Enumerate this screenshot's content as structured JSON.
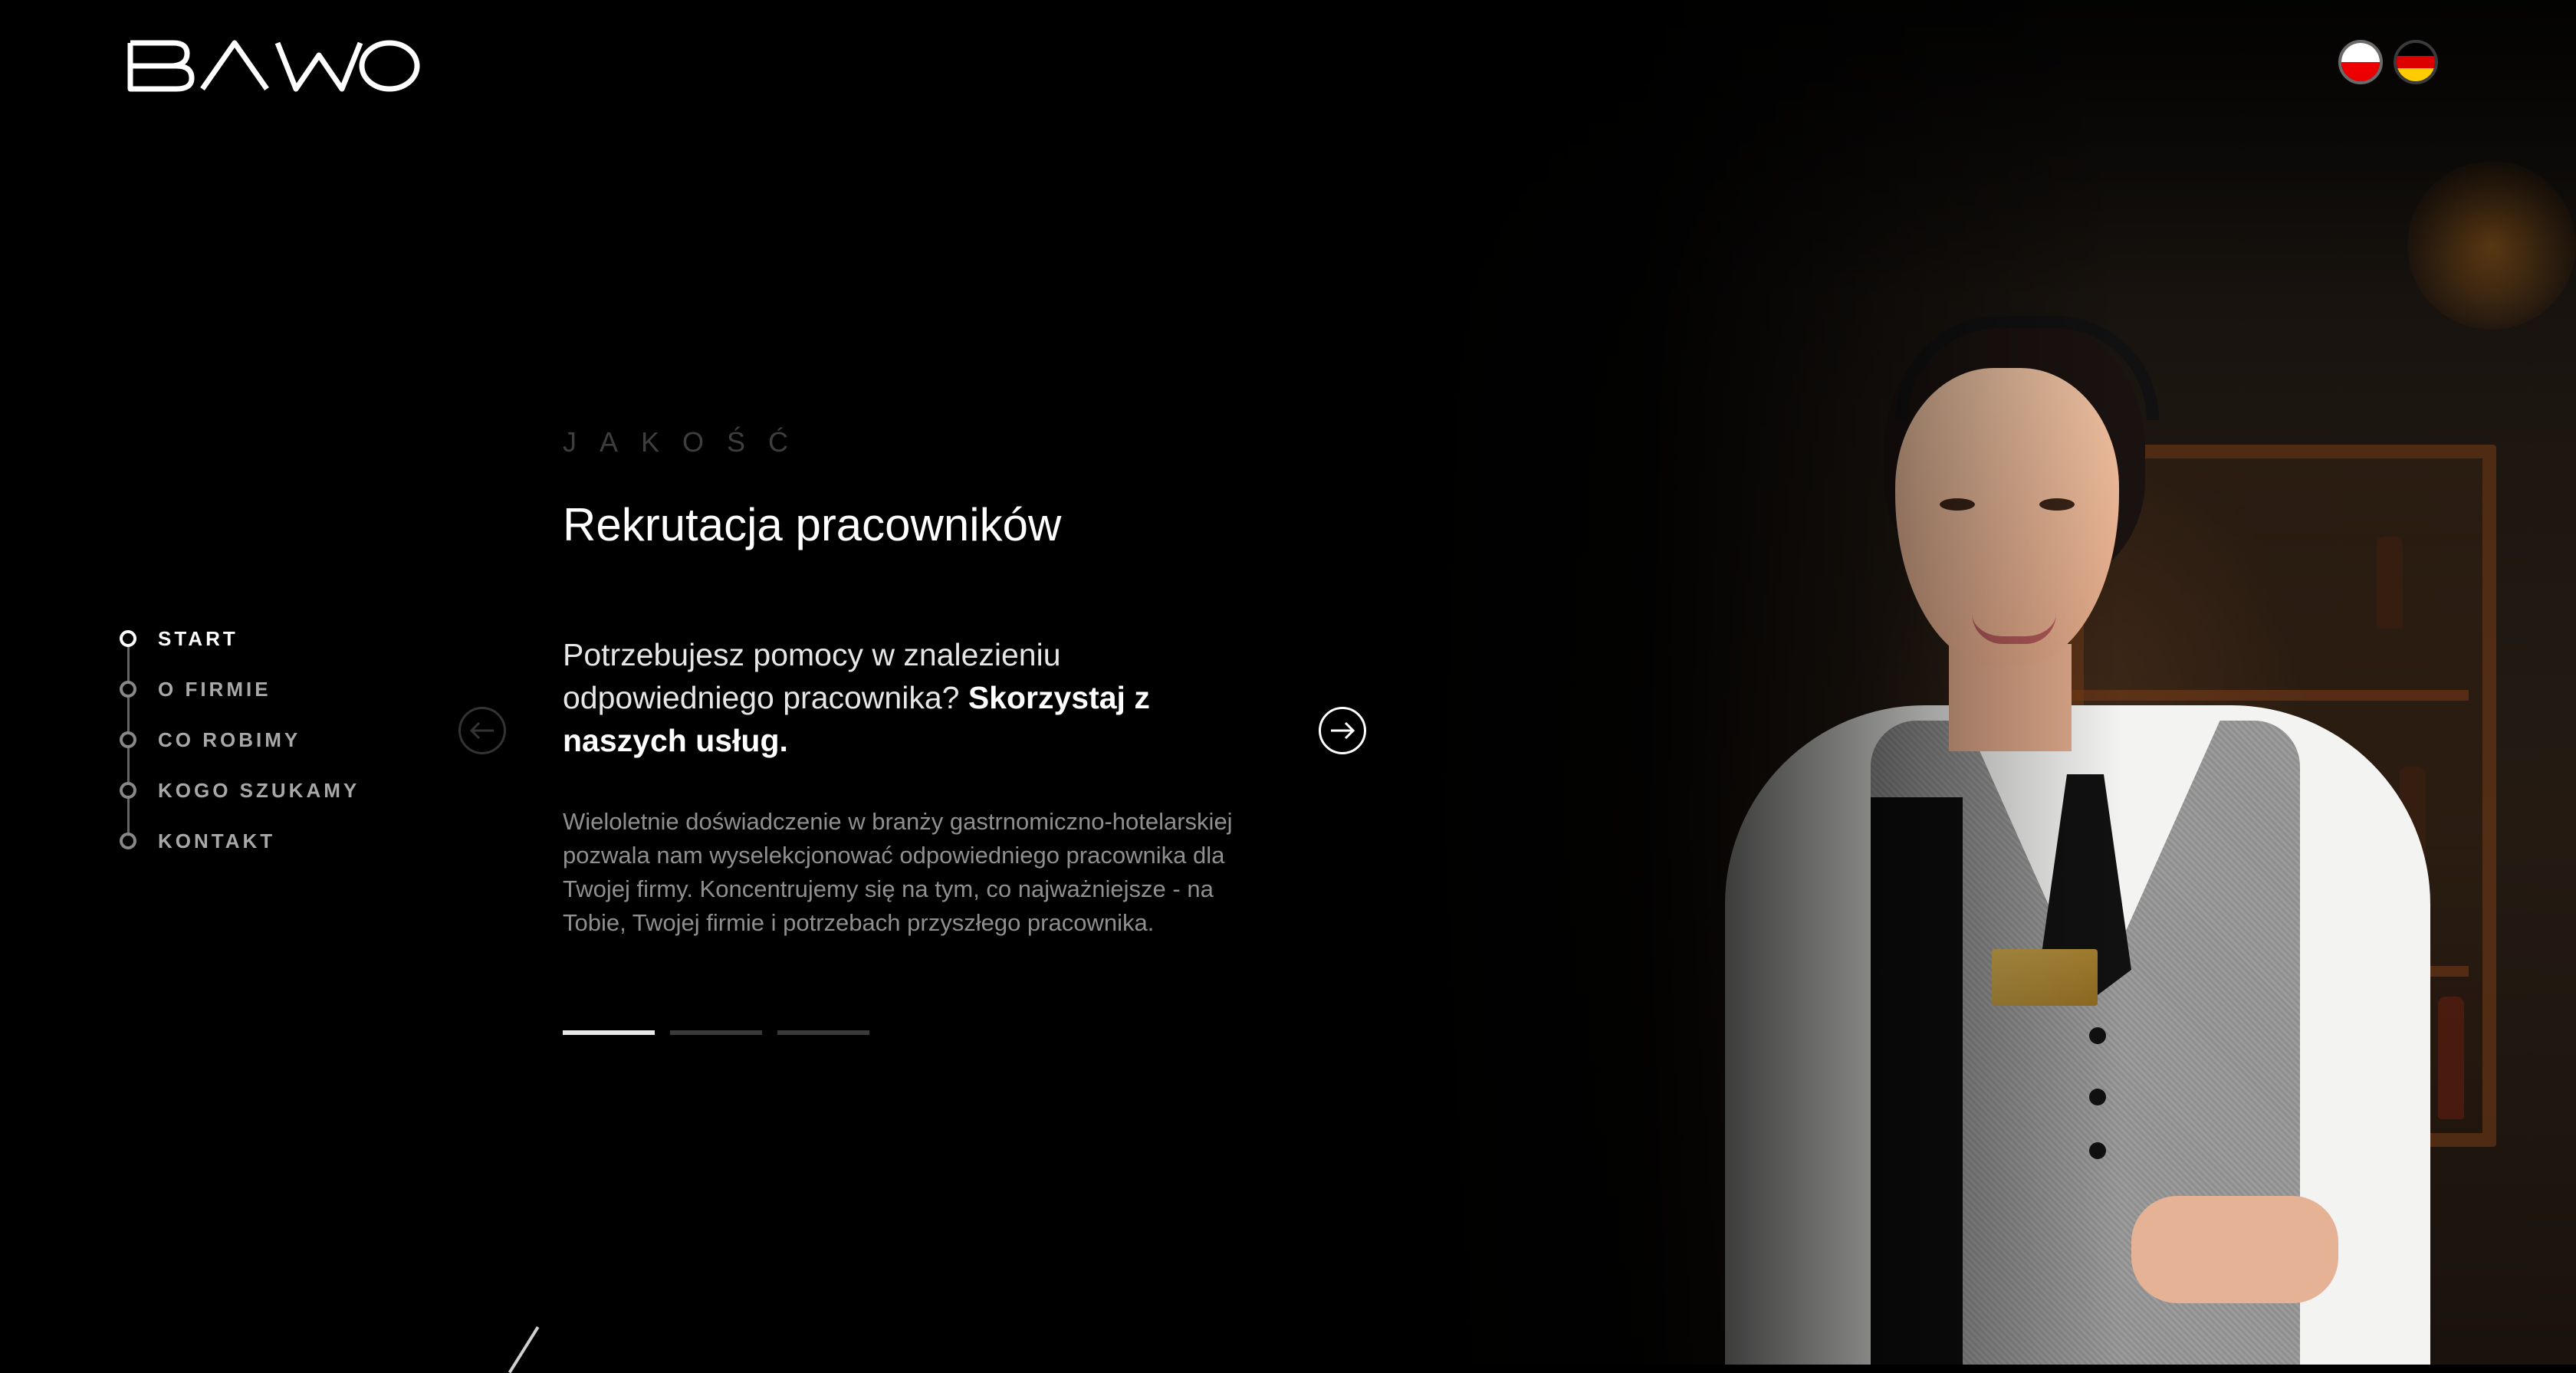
{
  "header": {
    "logo_text": "BAWO",
    "languages": [
      {
        "code": "pl",
        "name": "Polski",
        "active": true
      },
      {
        "code": "de",
        "name": "Deutsch",
        "active": false
      }
    ]
  },
  "sidebar": {
    "items": [
      {
        "label": "START",
        "active": true
      },
      {
        "label": "O FIRMIE",
        "active": false
      },
      {
        "label": "CO ROBIMY",
        "active": false
      },
      {
        "label": "KOGO SZUKAMY",
        "active": false
      },
      {
        "label": "KONTAKT",
        "active": false
      }
    ]
  },
  "slide": {
    "eyebrow": "JAKOŚĆ",
    "title": "Rekrutacja pracowników",
    "lead_regular": "Potrzebujesz pomocy w znalezieniu odpowiedniego pracownika? ",
    "lead_bold": "Skorzystaj z naszych usług.",
    "body": "Wieloletnie doświadczenie w branży gastrnomiczno-hotelarskiej pozwala nam wyselekcjonować odpowiedniego pracownika dla Twojej firmy. Koncentrujemy się na tym, co najważniejsze - na Tobie, Twojej firmie i potrzebach przyszłego pracownika."
  },
  "pager": {
    "total": 3,
    "active_index": 0
  },
  "icons": {
    "prev": "arrow-left-icon",
    "next": "arrow-right-icon"
  },
  "colors": {
    "background": "#000000",
    "text_primary": "#ffffff",
    "text_muted": "#8f8f8f",
    "nav_inactive": "#a8a8a8"
  }
}
